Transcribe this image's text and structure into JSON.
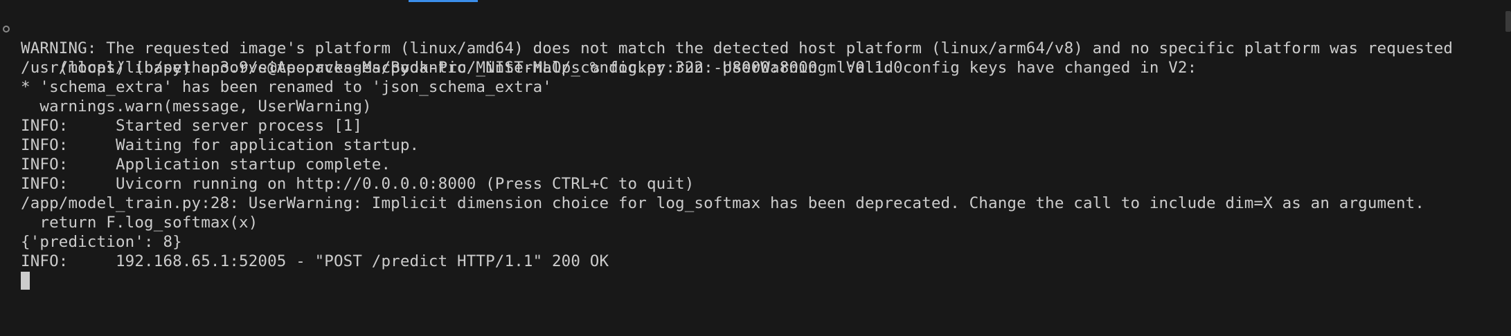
{
  "terminal": {
    "lines": [
      "(mlops) (base) apoorve@Apoorves-MacBook-Pro MNIST-MLOps % docker run -p8000:8000 ml:0.1.0",
      "WARNING: The requested image's platform (linux/amd64) does not match the detected host platform (linux/arm64/v8) and no specific platform was requested",
      "/usr/local/lib/python3.9/site-packages/pydantic/_internal/_config.py:322: UserWarning: Valid config keys have changed in V2:",
      "* 'schema_extra' has been renamed to 'json_schema_extra'",
      "  warnings.warn(message, UserWarning)",
      "INFO:     Started server process [1]",
      "INFO:     Waiting for application startup.",
      "INFO:     Application startup complete.",
      "INFO:     Uvicorn running on http://0.0.0.0:8000 (Press CTRL+C to quit)",
      "/app/model_train.py:28: UserWarning: Implicit dimension choice for log_softmax has been deprecated. Change the call to include dim=X as an argument.",
      "  return F.log_softmax(x)",
      "{'prediction': 8}",
      "INFO:     192.168.65.1:52005 - \"POST /predict HTTP/1.1\" 200 OK"
    ]
  },
  "colors": {
    "background": "#181818",
    "text": "#cccccc",
    "tab_accent": "#3b8eea"
  }
}
